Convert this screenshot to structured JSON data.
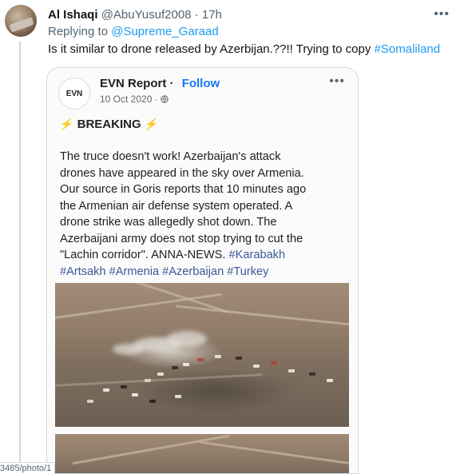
{
  "tweet": {
    "author_name": "Al Ishaqi",
    "handle": "@AbuYusuf2008",
    "separator": "·",
    "time": "17h",
    "more_label": "•••",
    "replying_prefix": "Replying to",
    "replying_to": "@Supreme_Garaad",
    "text": "Is it similar to drone released by Azerbijan.??!! Trying to copy",
    "hashtag": "#Somaliland"
  },
  "embedded_post": {
    "logo_text": "EVN",
    "page_name": "EVN Report",
    "separator": "·",
    "follow_label": "Follow",
    "date": "10 Oct 2020 ·",
    "more_label": "•••",
    "breaking_label": "BREAKING",
    "body_lines": [
      "The truce doesn't work!  Azerbaijan's attack",
      "drones have appeared in the sky over Armenia.",
      "Our source in Goris reports that 10 minutes ago",
      "the Armenian air defense system operated. A",
      "drone strike was allegedly shot down. The",
      "Azerbaijani army does not stop trying to cut the"
    ],
    "line7_text": "\"Lachin corridor\". ANNA-NEWS.",
    "line7_hashtag": "#Karabakh",
    "hashtags_line": "#Artsakh #Armenia #Azerbaijan #Turkey"
  },
  "status_url": "3485/photo/1",
  "colors": {
    "link_blue": "#1d9bf0",
    "fb_follow_blue": "#1877f2",
    "secondary_text": "#536471",
    "breaking_bolt": "#f2b81a"
  }
}
